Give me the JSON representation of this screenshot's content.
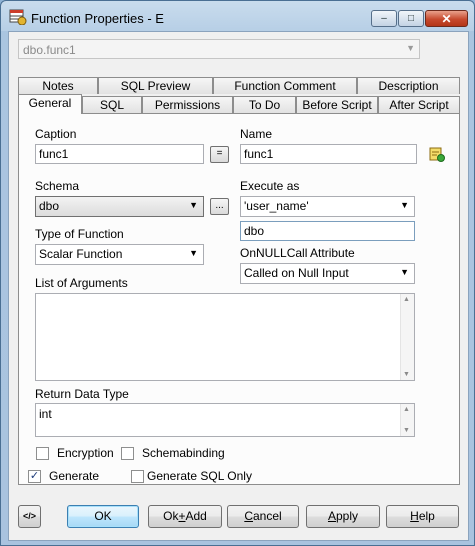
{
  "window": {
    "title": "Function Properties - E",
    "object_combo": "dbo.func1",
    "controls": {
      "minimize": "‒",
      "maximize": "□",
      "close": "✕"
    }
  },
  "tabs": {
    "row_back": [
      "Notes",
      "SQL Preview",
      "Function Comment",
      "Description"
    ],
    "row_front": [
      "General",
      "SQL",
      "Permissions",
      "To Do",
      "Before Script",
      "After Script"
    ],
    "active": "General"
  },
  "general": {
    "caption_label": "Caption",
    "caption_value": "func1",
    "equals_button": "=",
    "name_label": "Name",
    "name_value": "func1",
    "schema_label": "Schema",
    "schema_value": "dbo",
    "browse_button": "...",
    "execute_as_label": "Execute as",
    "execute_as_value": "'user_name'",
    "execute_as_user": "dbo",
    "type_label": "Type of Function",
    "type_value": "Scalar Function",
    "onnull_label": "OnNULLCall Attribute",
    "onnull_value": "Called on Null Input",
    "args_label": "List of Arguments",
    "args_value": "",
    "return_label": "Return Data Type",
    "return_value": "int",
    "encryption_label": "Encryption",
    "encryption_checked": false,
    "schemabinding_label": "Schemabinding",
    "schemabinding_checked": false,
    "generate_label": "Generate",
    "generate_checked": true,
    "generate_sql_only_label": "Generate SQL Only",
    "generate_sql_only_checked": false
  },
  "buttons": {
    "code_icon": "</>",
    "ok": "OK",
    "ok_add_prefix": "Ok",
    "ok_add_underlined": "+",
    "ok_add_suffix": "Add",
    "cancel_u": "C",
    "cancel_rest": "ancel",
    "apply_u": "A",
    "apply_rest": "pply",
    "help_u": "H",
    "help_rest": "elp"
  },
  "icons": {
    "app": "table-function-icon",
    "name_action": "rename-icon",
    "check_mark": "✓",
    "dropdown": "▼",
    "scroll_up": "▲",
    "scroll_down": "▼"
  }
}
